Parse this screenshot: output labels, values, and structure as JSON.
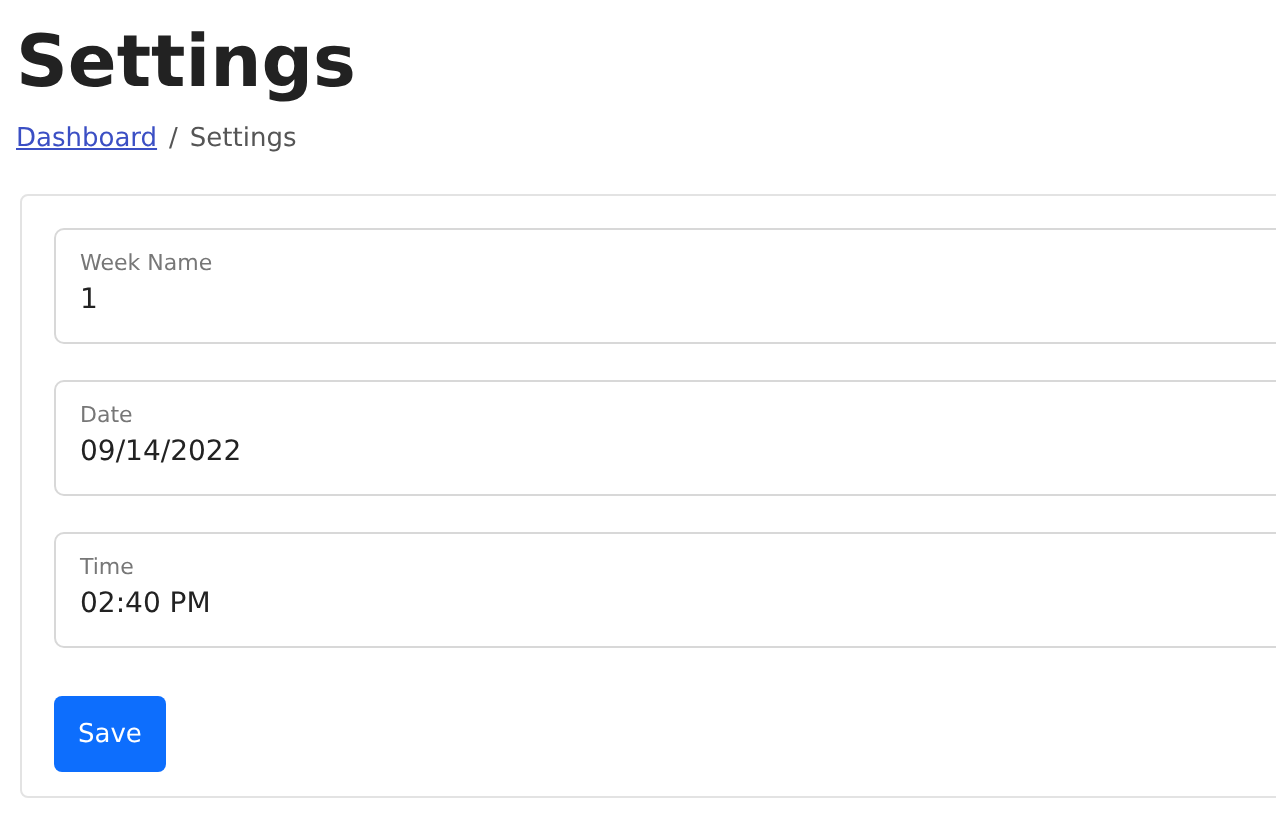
{
  "page": {
    "title": "Settings"
  },
  "breadcrumb_separator": "/",
  "breadcrumb": [
    {
      "label": "Dashboard",
      "kind": "link"
    },
    {
      "label": "Settings",
      "kind": "current"
    }
  ],
  "form": {
    "fields": [
      {
        "label": "Week Name",
        "value": "1"
      },
      {
        "label": "Date",
        "value": "09/14/2022"
      },
      {
        "label": "Time",
        "value": "02:40  PM"
      }
    ],
    "button": "Save"
  }
}
